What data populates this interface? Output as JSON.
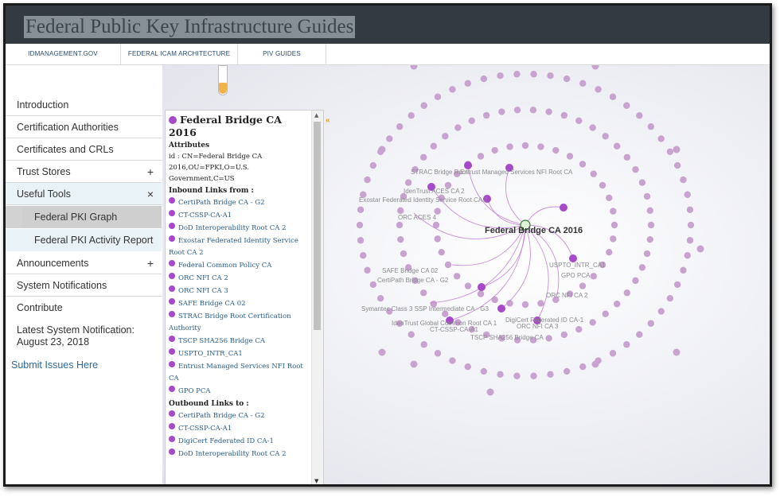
{
  "banner": {
    "title": "Federal Public Key Infrastructure Guides"
  },
  "topnav": [
    "IDMANAGEMENT.GOV",
    "FEDERAL ICAM ARCHITECTURE",
    "PIV GUIDES"
  ],
  "sidebar": {
    "items": [
      {
        "label": "Introduction"
      },
      {
        "label": "Certification Authorities"
      },
      {
        "label": "Certificates and CRLs"
      },
      {
        "label": "Trust Stores",
        "toggle": "+"
      },
      {
        "label": "Useful Tools",
        "toggle": "×"
      },
      {
        "label": "Federal PKI Graph"
      },
      {
        "label": "Federal PKI Activity Report"
      },
      {
        "label": "Announcements",
        "toggle": "+"
      },
      {
        "label": "System Notifications"
      },
      {
        "label": "Contribute"
      }
    ],
    "notification": "Latest System Notification: August 23, 2018",
    "submit": "Submit Issues Here"
  },
  "panel": {
    "title": "Federal Bridge CA 2016",
    "attributes_heading": "Attributes",
    "id_line": "id : CN=Federal Bridge CA 2016,OU=FPKI,O=U.S. Government,C=US",
    "inbound_heading": "Inbound Links from :",
    "inbound": [
      "CertiPath Bridge CA - G2",
      "CT-CSSP-CA-A1",
      "DoD Interoperability Root CA 2",
      "Exostar Federated Identity Service Root CA 2",
      "Federal Common Policy CA",
      "ORC NFI CA 2",
      "ORC NFI CA 3",
      "SAFE Bridge CA 02",
      "STRAC Bridge Root Certification Authority",
      "TSCP SHA256 Bridge CA",
      "USPTO_INTR_CA1",
      "Entrust Managed Services NFI Root CA",
      "GPO PCA"
    ],
    "outbound_heading": "Outbound Links to :",
    "outbound": [
      "CertiPath Bridge CA - G2",
      "CT-CSSP-CA-A1",
      "DigiCert Federated ID CA-1",
      "DoD Interoperability Root CA 2"
    ],
    "collapse": "«"
  },
  "graph": {
    "center_label": "Federal Bridge CA 2016",
    "node_color": "#a64ac9",
    "faded_color": "#c9a3cf",
    "labels": [
      "STRAC Bridge Root",
      "Entrust Managed Services NFI Root CA",
      "IdenTrust ACES CA 2",
      "Exostar Federated Identity Service Root CA 2",
      "ORC ACES 4",
      "SAFE Bridge CA 02",
      "CertiPath Bridge CA - G2",
      "USPTO_INTR_CA1",
      "GPO PCA",
      "ORC NFI CA 2",
      "Symantec Class 3 SSP Intermediate CA - G3",
      "IdenTrust Global Common Root CA 1",
      "DigiCert Federated ID CA-1",
      "CT-CSSP-CA-A1",
      "ORC NFI CA 3",
      "TSCP SHA256 Bridge CA"
    ]
  }
}
